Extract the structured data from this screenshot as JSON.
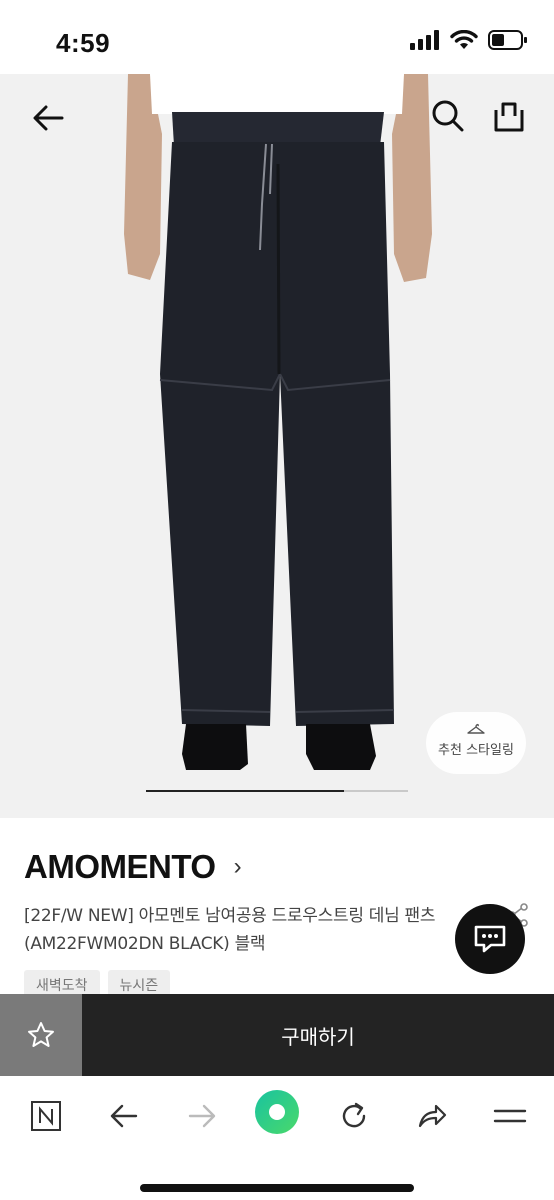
{
  "status_bar": {
    "time": "4:59"
  },
  "header": {
    "back_icon": "arrow-left-icon",
    "search_icon": "search-icon",
    "share_icon": "share-box-icon"
  },
  "gallery": {
    "style_recommend_label": "추천 스타일링"
  },
  "product": {
    "brand": "AMOMENTO",
    "brand_chevron": "›",
    "title": "[22F/W NEW] 아모멘토 남여공용 드로우스트링 데님 팬츠 (AM22FWM02DN BLACK) 블랙",
    "tags": [
      "새벽도착",
      "뉴시즌"
    ]
  },
  "buy_bar": {
    "wish_icon": "star-outline-icon",
    "buy_label": "구매하기"
  },
  "browser_toolbar": {
    "items": [
      "naver-n-icon",
      "arrow-back-icon",
      "arrow-forward-icon",
      "green-home-icon",
      "refresh-icon",
      "share-arrow-icon",
      "menu-icon"
    ]
  },
  "colors": {
    "buy_button": "#232323",
    "wish_button": "#7a7a7a",
    "hero_bg": "#f1f1f1",
    "green_button": "#2fd17a"
  }
}
